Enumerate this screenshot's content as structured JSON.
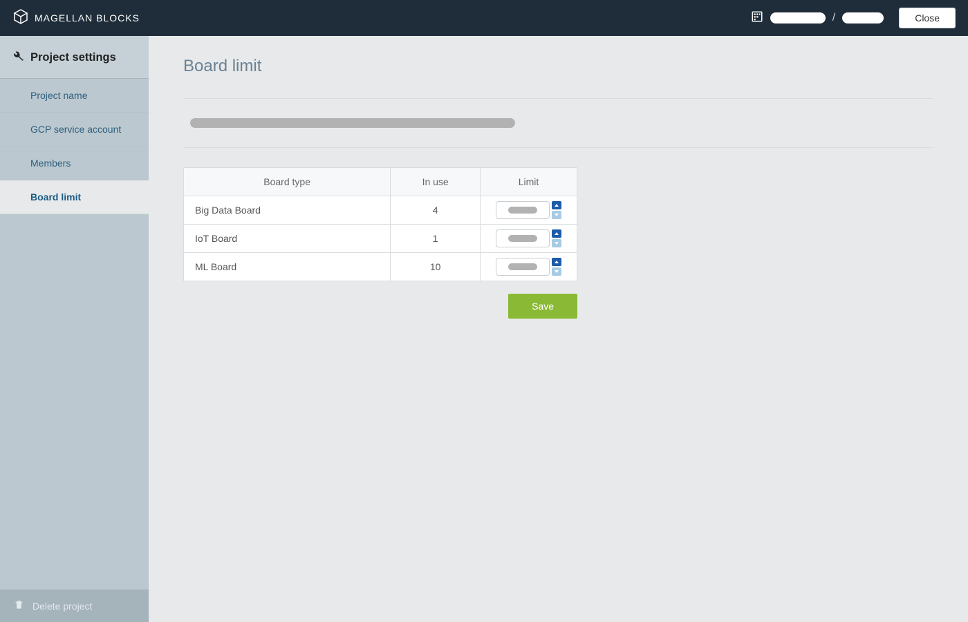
{
  "header": {
    "brand": "MAGELLAN BLOCKS",
    "separator": "/",
    "close_label": "Close"
  },
  "sidebar": {
    "title": "Project settings",
    "items": [
      {
        "label": "Project name",
        "active": false
      },
      {
        "label": "GCP service account",
        "active": false
      },
      {
        "label": "Members",
        "active": false
      },
      {
        "label": "Board limit",
        "active": true
      }
    ],
    "delete_label": "Delete project"
  },
  "main": {
    "title": "Board limit",
    "table": {
      "headers": {
        "type": "Board type",
        "in_use": "In use",
        "limit": "Limit"
      },
      "rows": [
        {
          "type": "Big Data Board",
          "in_use": "4"
        },
        {
          "type": "IoT Board",
          "in_use": "1"
        },
        {
          "type": "ML Board",
          "in_use": "10"
        }
      ]
    },
    "save_label": "Save"
  }
}
